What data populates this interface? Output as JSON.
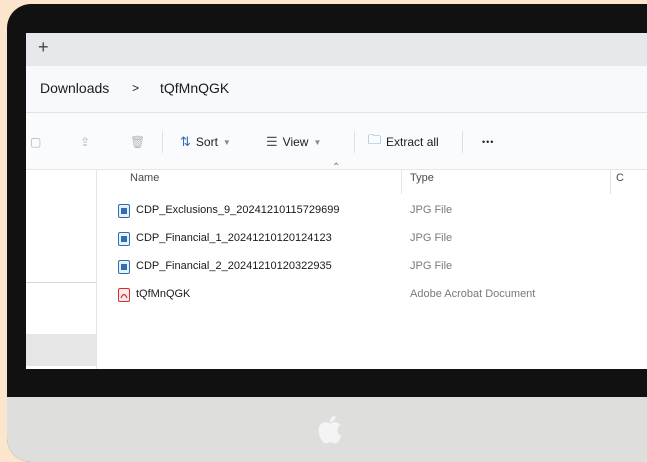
{
  "tabbar": {
    "new_tab": "+"
  },
  "breadcrumb": {
    "folder_parent": "Downloads",
    "separator": ">",
    "folder_current": "tQfMnQGK"
  },
  "toolbar": {
    "sort_label": "Sort",
    "view_label": "View",
    "extract_label": "Extract all",
    "more_label": "•••"
  },
  "columns": {
    "name": "Name",
    "type": "Type",
    "extra": "C"
  },
  "files": [
    {
      "name": "CDP_Exclusions_9_20241210115729699",
      "type": "JPG File",
      "icon": "image-file-icon"
    },
    {
      "name": "CDP_Financial_1_20241210120124123",
      "type": "JPG File",
      "icon": "image-file-icon"
    },
    {
      "name": "CDP_Financial_2_20241210120322935",
      "type": "JPG File",
      "icon": "image-file-icon"
    },
    {
      "name": "tQfMnQGK",
      "type": "Adobe Acrobat Document",
      "icon": "pdf-file-icon"
    }
  ],
  "colors": {
    "background": "#fbe6cd",
    "bezel": "#111111",
    "chin": "#dededd",
    "accent": "#2f6fb1",
    "pdf": "#d32f2f"
  }
}
